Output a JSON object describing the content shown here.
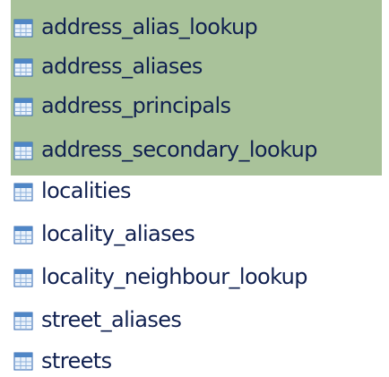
{
  "tables": [
    {
      "name": "address_alias_lookup",
      "selected": true
    },
    {
      "name": "address_aliases",
      "selected": true
    },
    {
      "name": "address_principals",
      "selected": true
    },
    {
      "name": "address_secondary_lookup",
      "selected": true
    },
    {
      "name": "localities",
      "selected": false
    },
    {
      "name": "locality_aliases",
      "selected": false
    },
    {
      "name": "locality_neighbour_lookup",
      "selected": false
    },
    {
      "name": "street_aliases",
      "selected": false
    },
    {
      "name": "streets",
      "selected": false
    }
  ],
  "icons": {
    "table": "table-icon"
  },
  "colors": {
    "selection_background": "#a9c29a",
    "text": "#102050",
    "icon_header": "#4f86c6",
    "icon_body": "#eaf2fb",
    "icon_border": "#2f66b0"
  }
}
